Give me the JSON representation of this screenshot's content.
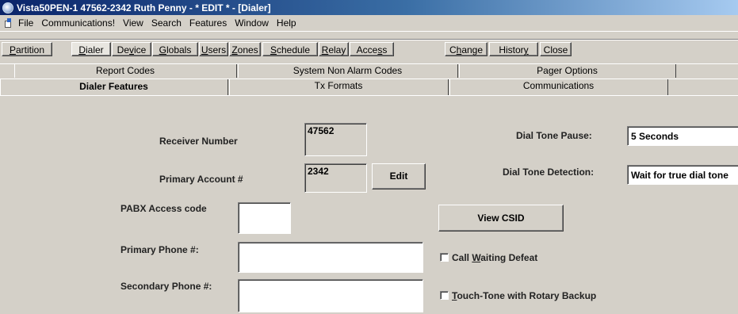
{
  "window": {
    "title": "Vista50PEN-1  47562-2342 Ruth Penny - * EDIT * - [Dialer]"
  },
  "menu": {
    "items": [
      "File",
      "Communications!",
      "View",
      "Search",
      "Features",
      "Window",
      "Help"
    ]
  },
  "toolbar": {
    "buttons": [
      {
        "pre": "",
        "u": "P",
        "post": "artition"
      },
      {
        "pre": "",
        "u": "D",
        "post": "ialer"
      },
      {
        "pre": "De",
        "u": "v",
        "post": "ice"
      },
      {
        "pre": "",
        "u": "G",
        "post": "lobals"
      },
      {
        "pre": "",
        "u": "U",
        "post": "sers"
      },
      {
        "pre": "",
        "u": "Z",
        "post": "ones"
      },
      {
        "pre": "",
        "u": "S",
        "post": "chedule"
      },
      {
        "pre": "",
        "u": "R",
        "post": "elay"
      },
      {
        "pre": "Acce",
        "u": "s",
        "post": "s"
      },
      {
        "pre": "C",
        "u": "h",
        "post": "ange"
      },
      {
        "pre": "Histor",
        "u": "y",
        "post": ""
      },
      {
        "pre": "Close",
        "u": "",
        "post": ""
      }
    ]
  },
  "tabs": {
    "row1": [
      "Report Codes",
      "System Non Alarm Codes",
      "Pager Options"
    ],
    "row2": [
      "Dialer Features",
      "Tx Formats",
      "Communications"
    ]
  },
  "form": {
    "receiver_number_label": "Receiver Number",
    "receiver_number_value": "47562",
    "primary_account_label": "Primary Account #",
    "primary_account_value": "2342",
    "edit_button": "Edit",
    "pabx_label": "PABX Access code",
    "pabx_value": "",
    "primary_phone_label": "Primary Phone #:",
    "primary_phone_value": "",
    "secondary_phone_label": "Secondary Phone #:",
    "secondary_phone_value": "",
    "dial_tone_pause_label": "Dial Tone Pause:",
    "dial_tone_pause_value": "5 Seconds",
    "dial_tone_detection_label": "Dial Tone Detection:",
    "dial_tone_detection_value": "Wait for true dial tone",
    "view_csid_button": "View CSID",
    "call_waiting": {
      "pre": "Call ",
      "u": "W",
      "post": "aiting Defeat",
      "checked": false
    },
    "touch_tone": {
      "pre": "",
      "u": "T",
      "post": "ouch-Tone with Rotary Backup",
      "checked": false
    }
  }
}
